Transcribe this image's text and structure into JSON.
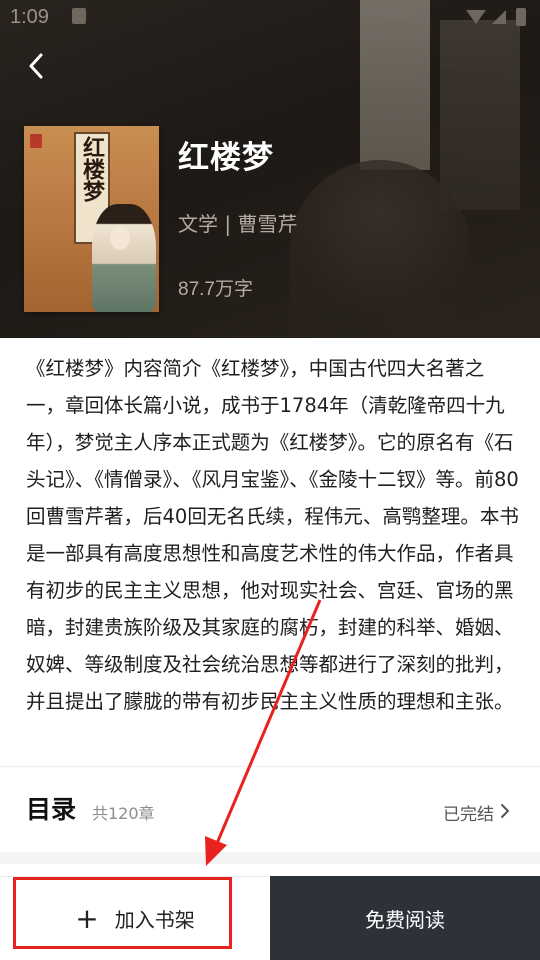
{
  "status_bar": {
    "time": "1:09"
  },
  "header": {
    "back_icon": "chevron-left-icon",
    "book": {
      "title": "红楼梦",
      "meta": "文学 | 曹雪芹",
      "word_count": "87.7万字",
      "cover_title": "红楼梦"
    }
  },
  "description": "《红楼梦》内容简介《红楼梦》，中国古代四大名著之一，章回体长篇小说，成书于1784年（清乾隆帝四十九年），梦觉主人序本正式题为《红楼梦》。它的原名有《石头记》、《情僧录》、《风月宝鉴》、《金陵十二钗》等。前80回曹雪芹著，后40回无名氏续，程伟元、高鹗整理。本书是一部具有高度思想性和高度艺术性的伟大作品，作者具有初步的民主主义思想，他对现实社会、宫廷、官场的黑暗，封建贵族阶级及其家庭的腐朽，封建的科举、婚姻、奴婢、等级制度及社会统治思想等都进行了深刻的批判，并且提出了朦胧的带有初步民主主义性质的理想和主张。",
  "toc": {
    "title": "目录",
    "count": "共120章",
    "status": "已完结",
    "chevron_icon": "chevron-right-icon"
  },
  "bottom_bar": {
    "add_to_shelf": {
      "icon": "plus-icon",
      "icon_glyph": "+",
      "label": "加入书架"
    },
    "read_free": {
      "label": "免费阅读"
    }
  },
  "annotation": {
    "color": "#e8231f"
  },
  "colors": {
    "header_bg": "#1d1915",
    "read_button_bg": "#2d313a"
  }
}
